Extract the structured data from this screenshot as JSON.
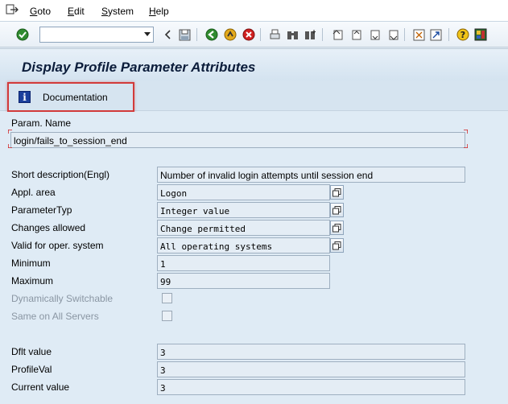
{
  "menu": {
    "items": [
      {
        "label": "Goto",
        "accel": "G",
        "rest": "oto"
      },
      {
        "label": "Edit",
        "accel": "E",
        "rest": "dit"
      },
      {
        "label": "System",
        "accel": "S",
        "rest": "ystem"
      },
      {
        "label": "Help",
        "accel": "H",
        "rest": "elp"
      }
    ]
  },
  "toolbar": {
    "command_field_value": ""
  },
  "title": "Display Profile Parameter Attributes",
  "app_toolbar": {
    "documentation_label": "Documentation"
  },
  "form": {
    "param_name_label": "Param. Name",
    "param_name_value": "login/fails_to_session_end",
    "short_description_label": "Short description(Engl)",
    "short_description_value": "Number of invalid login attempts until session end",
    "appl_area_label": "Appl. area",
    "appl_area_value": "Logon",
    "parameter_type_label": "ParameterTyp",
    "parameter_type_value": "Integer value",
    "changes_allowed_label": "Changes allowed",
    "changes_allowed_value": "Change permitted",
    "valid_os_label": "Valid for oper. system",
    "valid_os_value": "All operating systems",
    "minimum_label": "Minimum",
    "minimum_value": "1",
    "maximum_label": "Maximum",
    "maximum_value": "99",
    "dynamically_switchable_label": "Dynamically Switchable",
    "same_on_all_servers_label": "Same on All Servers",
    "default_value_label": "Dflt value",
    "default_value": "3",
    "profile_value_label": "ProfileVal",
    "profile_value": "3",
    "current_value_label": "Current value",
    "current_value": "3"
  }
}
